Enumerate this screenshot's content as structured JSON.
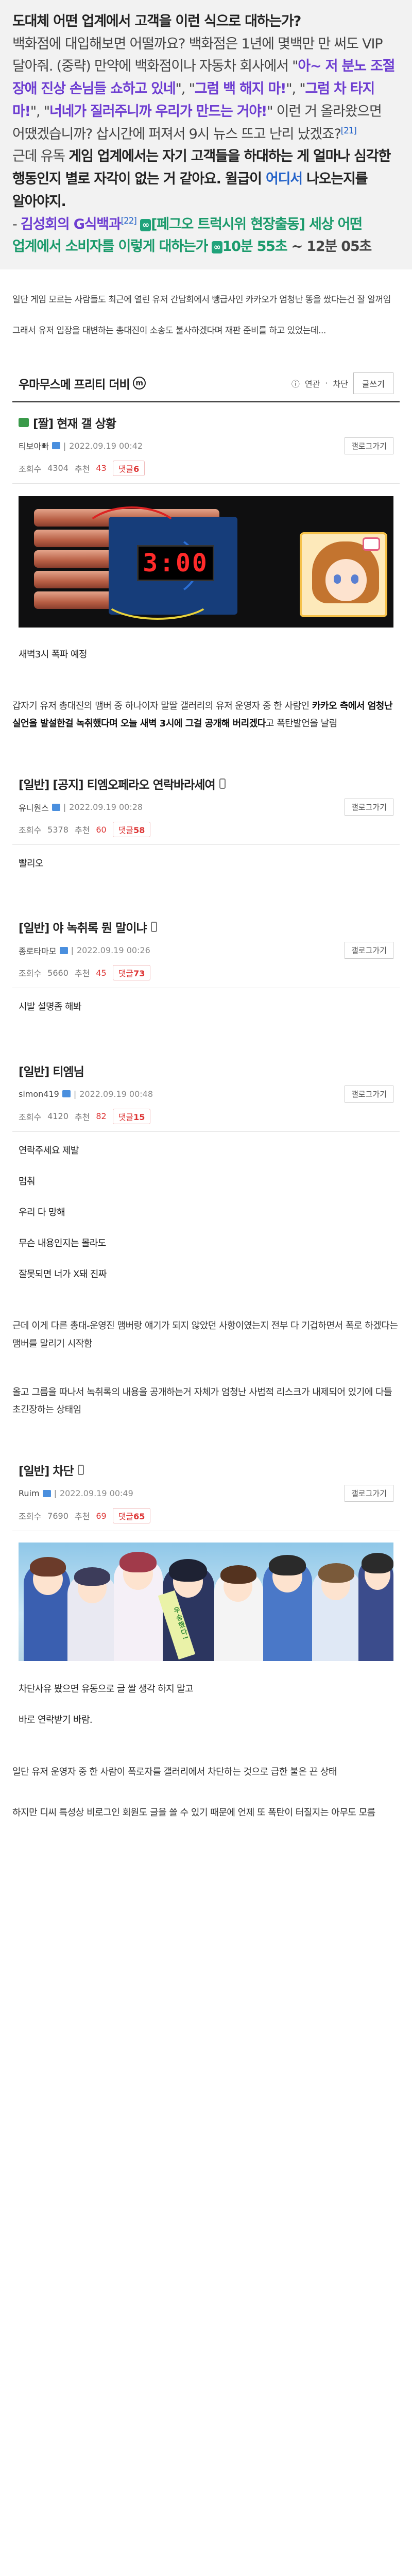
{
  "quote": {
    "title": "도대체 어떤 업계에서 고객을 이런 식으로 대하는가?",
    "p1": "백화점에 대입해보면 어떨까요? 백화점은 1년에 몇백만 만 써도 VIP 달아줘. (중략) 만약에 백화점이나 자동차 회사에서 \"",
    "q_a": "아~ 저 분노 조절 장애 진상 손님들 쇼하고 있네",
    "sep1": "\", \"",
    "q_b": "그럼 백 해지 마!",
    "sep2": "\", \"",
    "q_c": "그럼 차 타지 마!",
    "sep3": "\", \"",
    "q_d": "너네가 질러주니까 우리가 만드는 거야!",
    "p2": "\" 이런 거 올라왔으면 어땠겠습니까? 삽시간에 퍼져서 9시 뉴스 뜨고 난리 났겠죠?",
    "ref1": "[21]",
    "p3_pre": "근데 유독 ",
    "p3_em": "게임 업계에서는 자기 고객들을 하대하는 게 얼마나 심각한 행동인지 별로 자각이 없는 거 같아요. 윌급이 ",
    "p3_link": "어디서",
    "p3_post": " 나오는지를 알아야지.",
    "src_pre": "- ",
    "src_name": "김성회의 G식백과",
    "ref2": "[22]",
    "src_icon": "∞",
    "src_video": "[페그오 트럭시위 현장출동] 세상 어떤 업계에서 소비자를 이렇게 대하는가",
    "src_icon2": "∞",
    "src_time": "10분 55초",
    "src_tail": " ~ 12분 05초"
  },
  "intro1": "일단 게임 모르는 사람들도 최근에 열린 유저 간담회에서 뺑급사인 카카오가 엄청난 똥을 쌌다는건 잘 알꺼임",
  "intro2": "그래서 유저 입장을 대변하는 총대진이 소송도 불사하겠다며 재판 준비를 하고 있었는데...",
  "board": {
    "title": "우마무스메 프리티 더비",
    "badge": "m",
    "related": "연관",
    "block": "차단",
    "write": "글쓰기"
  },
  "posts": [
    {
      "title": "[짤] 현재 갤 상황",
      "author": "티보아빠",
      "date": "2022.09.19 00:42",
      "views_label": "조회수",
      "views": "4304",
      "rec_label": "추천",
      "rec": "43",
      "cm_label": "댓글",
      "cm": "6",
      "gallery": "갤로그가기",
      "timer": "3:00",
      "body": [
        "새벽3시 폭파 예정"
      ]
    },
    {
      "title": "[일반] [공지] 티엠오페라오 연락바라세여",
      "author": "유니원스",
      "date": "2022.09.19 00:28",
      "views_label": "조회수",
      "views": "5378",
      "rec_label": "추천",
      "rec": "60",
      "cm_label": "댓글",
      "cm": "58",
      "gallery": "갤로그가기",
      "body": [
        "빨리오"
      ]
    },
    {
      "title": "[일반] 야 녹취록 뭔 말이냐",
      "author": "종로타마모",
      "date": "2022.09.19 00:26",
      "views_label": "조회수",
      "views": "5660",
      "rec_label": "추천",
      "rec": "45",
      "cm_label": "댓글",
      "cm": "73",
      "gallery": "갤로그가기",
      "body": [
        "시발 설명좀 해봐"
      ]
    },
    {
      "title": "[일반] 티엠님",
      "author": "simon419",
      "date": "2022.09.19 00:48",
      "views_label": "조회수",
      "views": "4120",
      "rec_label": "추천",
      "rec": "82",
      "cm_label": "댓글",
      "cm": "15",
      "gallery": "갤로그가기",
      "body": [
        "연락주세요 제발",
        "멈춰",
        "우리 다 망해",
        "무슨 내용인지는 몰라도",
        "잘못되면 너가 X돼 진짜"
      ]
    },
    {
      "title": "[일반] 차단",
      "author": "Ruim",
      "date": "2022.09.19 00:49",
      "views_label": "조회수",
      "views": "7690",
      "rec_label": "추천",
      "rec": "69",
      "cm_label": "댓글",
      "cm": "65",
      "gallery": "갤로그가기",
      "sash": "우승했다!",
      "body": [
        "차단사유 봤으면 유동으로 글 쌀 생각 하지 말고",
        "바로 연락받기 바람."
      ]
    }
  ],
  "notice": {
    "intro": "갑자기 유저 총대진의 맴버 중 하나이자 말딸 갤러리의 유저 운영자 중 한 사람인 ",
    "emph": "카카오 측에서 엄청난 실언을 발설한걸 녹취했다며 오늘 새벽 3시에 그걸 공개해 버리겠다",
    "tail": "고 폭탄발언을 날림"
  },
  "mid1": "근데 이게 다른 총대-운영진 맴버랑 얘기가 되지 않았던 사항이였는지 전부 다 기겁하면서 폭로 하겠다는 맴버를 말리기 시작함",
  "mid2": "올고 그름을 따나서 녹취록의 내용을 공개하는거 자체가 엄청난 사법적 리스크가 내제되어 있기에 다들 초긴장하는 상태임",
  "end1": "일단 유저 운영자 중 한 사람이 폭로자를 갤러리에서 차단하는 것으로 급한 불은 끈 상태",
  "end2": "하지만 디씨 특성상 비로그인 회원도 글을 쓸 수 있기 때문에 언제 또 폭탄이 터질지는 아무도 모름"
}
